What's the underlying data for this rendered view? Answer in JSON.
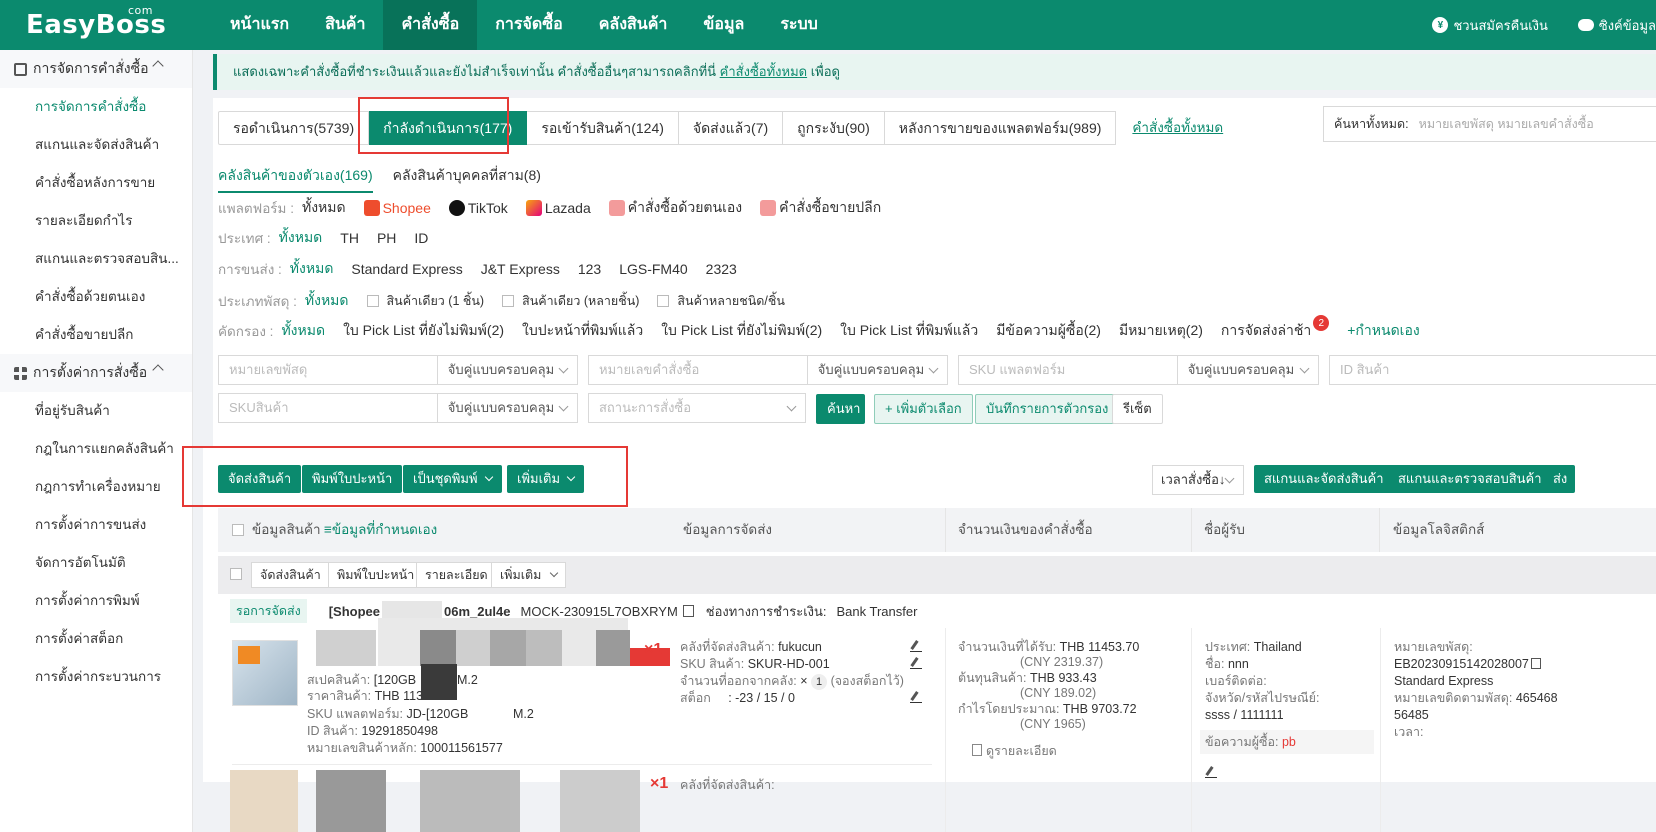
{
  "brand": {
    "name": "EasyBoss",
    "suffix": "com"
  },
  "nav": [
    "หน้าแรก",
    "สินค้า",
    "คำสั่งซื้อ",
    "การจัดซื้อ",
    "คลังสินค้า",
    "ข้อมูล",
    "ระบบ"
  ],
  "top_right": {
    "refund": "ชวนสมัครคืนเงิน",
    "sync": "ซิงค์ข้อมูล"
  },
  "sidebar": {
    "group1": "การจัดการคำสั่งซื้อ",
    "group1_items": [
      "การจัดการคำสั่งซื้อ",
      "สแกนและจัดส่งสินค้า",
      "คำสั่งซื้อหลังการขาย",
      "รายละเอียดกำไร",
      "สแกนและตรวจสอบสิน...",
      "คำสั่งซื้อด้วยตนเอง",
      "คำสั่งซื้อขายปลีก"
    ],
    "group2": "การตั้งค่าการสั่งซื้อ",
    "group2_items": [
      "ที่อยู่รับสินค้า",
      "กฎในการแยกคลังสินค้า",
      "กฎการทำเครื่องหมาย",
      "การตั้งค่าการขนส่ง",
      "จัดการอัตโนมัติ",
      "การตั้งค่าการพิมพ์",
      "การตั้งค่าสต็อก",
      "การตั้งค่ากระบวนการ"
    ]
  },
  "notice": {
    "text": "แสดงเฉพาะคำสั่งซื้อที่ชำระเงินแล้วและยังไม่สำเร็จเท่านั้น คำสั่งซื้ออื่นๆสามารถคลิกที่นี่ ",
    "link": "คำสั่งซื้อทั้งหมด",
    "tail": " เพื่อดู"
  },
  "tabs": [
    "รอดำเนินการ(5739)",
    "กำลังดำเนินการ(177)",
    "รอเข้ารับสินค้า(124)",
    "จัดส่งแล้ว(7)",
    "ถูกระงับ(90)",
    "หลังการขายของแพลตฟอร์ม(989)"
  ],
  "tabs_link": "คำสั่งซื้อทั้งหมด",
  "search_all": {
    "label": "ค้นหาทั้งหมด:",
    "placeholder": "หมายเลขพัสดุ หมายเลขคำสั่งซื้อ"
  },
  "subtabs": [
    "คลังสินค้าของตัวเอง(169)",
    "คลังสินค้าบุคคลที่สาม(8)"
  ],
  "filters": {
    "platform_label": "แพลตฟอร์ม :",
    "platform_all": "ทั้งหมด",
    "platforms": [
      "Shopee",
      "TikTok",
      "Lazada",
      "คำสั่งซื้อด้วยตนเอง",
      "คำสั่งซื้อขายปลีก"
    ],
    "country_label": "ประเทศ :",
    "country_all": "ทั้งหมด",
    "countries": [
      "TH",
      "PH",
      "ID"
    ],
    "shipping_label": "การขนส่ง :",
    "shipping_all": "ทั้งหมด",
    "shipping": [
      "Standard Express",
      "J&T Express",
      "123",
      "LGS-FM40",
      "2323"
    ],
    "parcel_label": "ประเภทพัสดุ :",
    "parcel_all": "ทั้งหมด",
    "parcel": [
      "สินค้าเดียว (1 ชิ้น)",
      "สินค้าเดียว (หลายชิ้น)",
      "สินค้าหลายชนิด/ชิ้น"
    ],
    "screen_label": "คัดกรอง :",
    "screen_all": "ทั้งหมด",
    "screen": [
      "ใบ Pick List ที่ยังไม่พิมพ์(2)",
      "ใบปะหน้าที่พิมพ์แล้ว",
      "ใบ Pick List ที่ยังไม่พิมพ์(2)",
      "ใบ Pick List ที่พิมพ์แล้ว",
      "มีข้อความผู้ซื้อ(2)",
      "มีหมายเหตุ(2)",
      "การจัดส่งล่าช้า"
    ],
    "screen_badge": "2",
    "screen_custom": "+กำหนดเอง"
  },
  "inputs": {
    "parcel_no": "หมายเลขพัสดุ",
    "order_no": "หมายเลขคำสั่งซื้อ",
    "sku_platform": "SKU แพลตฟอร์ม",
    "product_id": "ID สินค้า",
    "sku": "SKUสินค้า",
    "order_status": "สถานะการสั่งซื้อ",
    "match": "จับคู่แบบครอบคลุม"
  },
  "buttons": {
    "search": "ค้นหา",
    "add_option": "+ เพิ่มตัวเลือก",
    "save_filter": "บันทึกรายการตัวกรอง",
    "reset": "รีเซ็ต"
  },
  "actions": {
    "ship": "จัดส่งสินค้า",
    "print_label": "พิมพ์ใบปะหน้า",
    "print_set": "เป็นชุดพิมพ์",
    "more": "เพิ่มเติม",
    "sort": "เวลาสั่งซื้อ↓",
    "scan_ship": "สแกนและจัดส่งสินค้า",
    "scan_check": "สแกนและตรวจสอบสินค้า",
    "cut": "ส่ง"
  },
  "table": {
    "headers": [
      "ข้อมูลสินค้า",
      "≡ข้อมูลที่กำหนดเอง",
      "ข้อมูลการจัดส่ง",
      "จำนวนเงินของคำสั่งซื้อ",
      "ชื่อผู้รับ",
      "ข้อมูลโลจิสติกส์"
    ],
    "bulk": [
      "จัดส่งสินค้า",
      "พิมพ์ใบปะหน้า",
      "รายละเอียด",
      "เพิ่มเติม"
    ]
  },
  "order": {
    "status": "รอการจัดส่ง",
    "shop": "[Shopee",
    "shop_tail": "06m_2ul4e",
    "order_no": "MOCK-230915L7OBXRYM",
    "payment_label": "ช่องทางการชำระเงิน:",
    "payment": "Bank Transfer",
    "spec_label": "สเปคสินค้า:",
    "spec_val": "[120GB",
    "spec_tail": "M.2",
    "price_label": "ราคาสินค้า:",
    "price_val": "THB 1136",
    "sku_platform_label": "SKU แพลตฟอร์ม:",
    "sku_platform_val": "JD-[120GB",
    "sku_platform_tail": "M.2",
    "product_id_label": "ID สินค้า:",
    "product_id_val": "19291850498",
    "main_no_label": "หมายเลขสินค้าหลัก:",
    "main_no_val": "100011561577",
    "qty": "×1",
    "warehouse_label": "คลังที่จัดส่งสินค้า:",
    "warehouse_val": "fukucun",
    "sku_label": "SKU สินค้า:",
    "sku_val": "SKUR-HD-001",
    "outqty_label": "จำนวนที่ออกจากคลัง:",
    "outqty_val": "×",
    "outqty_num": "1",
    "outqty_note": "(จองสต็อกไว้)",
    "stock_label": "สต็อก",
    "stock_val": ": -23 / 15 / 0",
    "received_label": "จำนวนเงินที่ได้รับ:",
    "received_val": "THB 11453.70",
    "received_cny": "(CNY 2319.37)",
    "cost_label": "ต้นทุนสินค้า:",
    "cost_val": "THB 933.43",
    "cost_cny": "(CNY 189.02)",
    "profit_label": "กำไรโดยประมาณ:",
    "profit_val": "THB 9703.72",
    "profit_cny": "(CNY 1965)",
    "detail_link": "ดูรายละเอียด",
    "country_label": "ประเทศ:",
    "country_val": "Thailand",
    "name_label": "ชื่อ:",
    "name_val": "nnn",
    "phone_label": "เบอร์ติดต่อ:",
    "province_label": "จังหวัด/รหัสไปรษณีย์:",
    "province_val": "ssss / 1111111",
    "buyer_msg_label": "ข้อความผู้ซื้อ:",
    "buyer_msg_val": "pb",
    "tracking_label": "หมายเลขพัสดุ:",
    "tracking_val": "EB20230915142028007",
    "carrier": "Standard Express",
    "tracking_follow_label": "หมายเลขติดตามพัสดุ:",
    "tracking_follow_val": "465468",
    "tracking_follow_val2": "56485",
    "time_label": "เวลา:",
    "warehouse_label2": "คลังที่จัดส่งสินค้า:",
    "qty2": "×1"
  }
}
